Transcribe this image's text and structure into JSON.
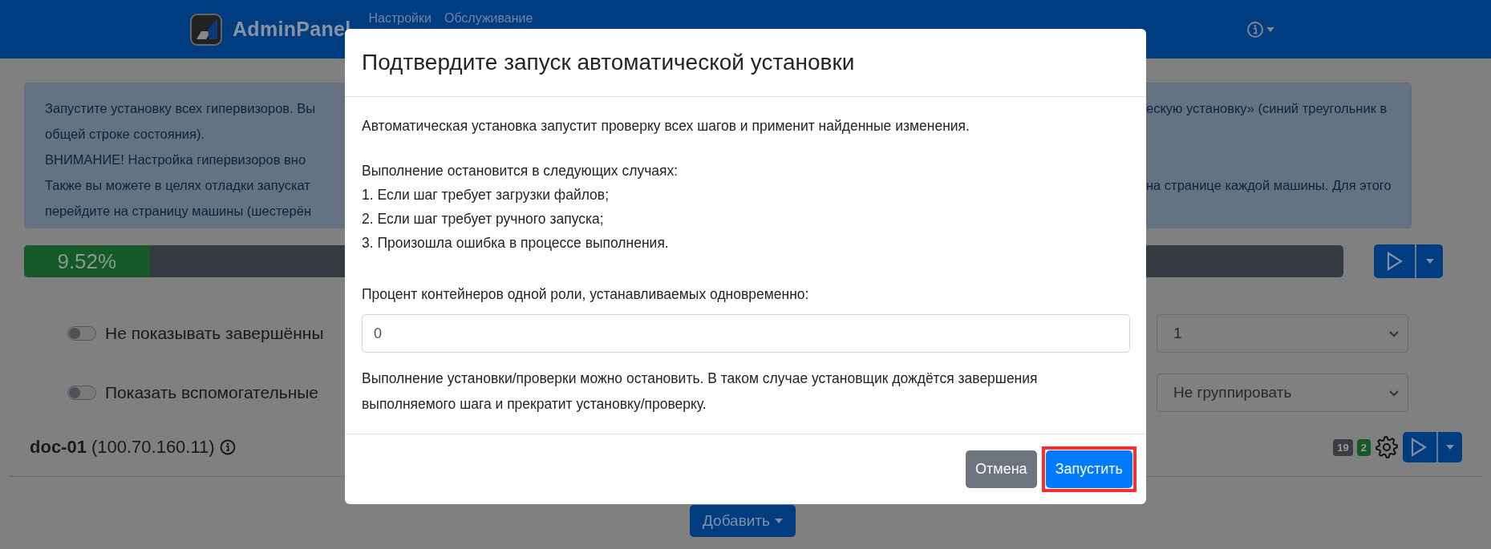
{
  "navbar": {
    "brand": "AdminPanel",
    "links": [
      {
        "label": "Настройки"
      },
      {
        "label": "Обслуживание"
      }
    ]
  },
  "alert": {
    "lines": [
      {
        "left": "Запустите установку всех гипервизоров. Вы",
        "right": "ескую установку» (синий треугольник в"
      },
      {
        "left": "общей строке состояния)."
      },
      {
        "left": "ВНИМАНИЕ! Настройка гипервизоров вно"
      },
      {
        "left": "Также вы можете в целях отладки запускат",
        "right": "на странице каждой машины. Для этого"
      },
      {
        "left": "перейдите на страницу машины (шестерён"
      }
    ]
  },
  "progress": {
    "level": 0.0952,
    "label": "9.52%"
  },
  "toggles": [
    {
      "label": "Не показывать завершённы",
      "on": false
    },
    {
      "label": "Показать вспомогательные",
      "on": false
    }
  ],
  "selects": [
    {
      "value": "1"
    },
    {
      "value": "Не группировать"
    }
  ],
  "machine": {
    "name": "doc-01",
    "address": "(100.70.160.11)",
    "badges": [
      {
        "text": "19",
        "color": "#3a3d41"
      },
      {
        "text": "2",
        "color": "#165a29"
      }
    ]
  },
  "add_button": {
    "label": "Добавить"
  },
  "modal": {
    "title": "Подтвердите запуск автоматической установки",
    "intro": "Автоматическая установка запустит проверку всех шагов и применит найденные изменения.",
    "stop_lines": [
      "Выполнение остановится в следующих случаях:",
      "1. Если шаг требует загрузки файлов;",
      "2. Если шаг требует ручного запуска;",
      "3. Произошла ошибка в процессе выполнения."
    ],
    "field_label": "Процент контейнеров одной роли, устанавливаемых одновременно:",
    "field_value": "0",
    "note": "Выполнение установки/проверки можно остановить. В таком случае установщик дождётся завершения выполняемого шага и прекратит установку/проверку.",
    "buttons": [
      {
        "label": "Отмена",
        "kind": "secondary",
        "highlighted": false
      },
      {
        "label": "Запустить",
        "kind": "primary",
        "highlighted": true
      }
    ]
  }
}
